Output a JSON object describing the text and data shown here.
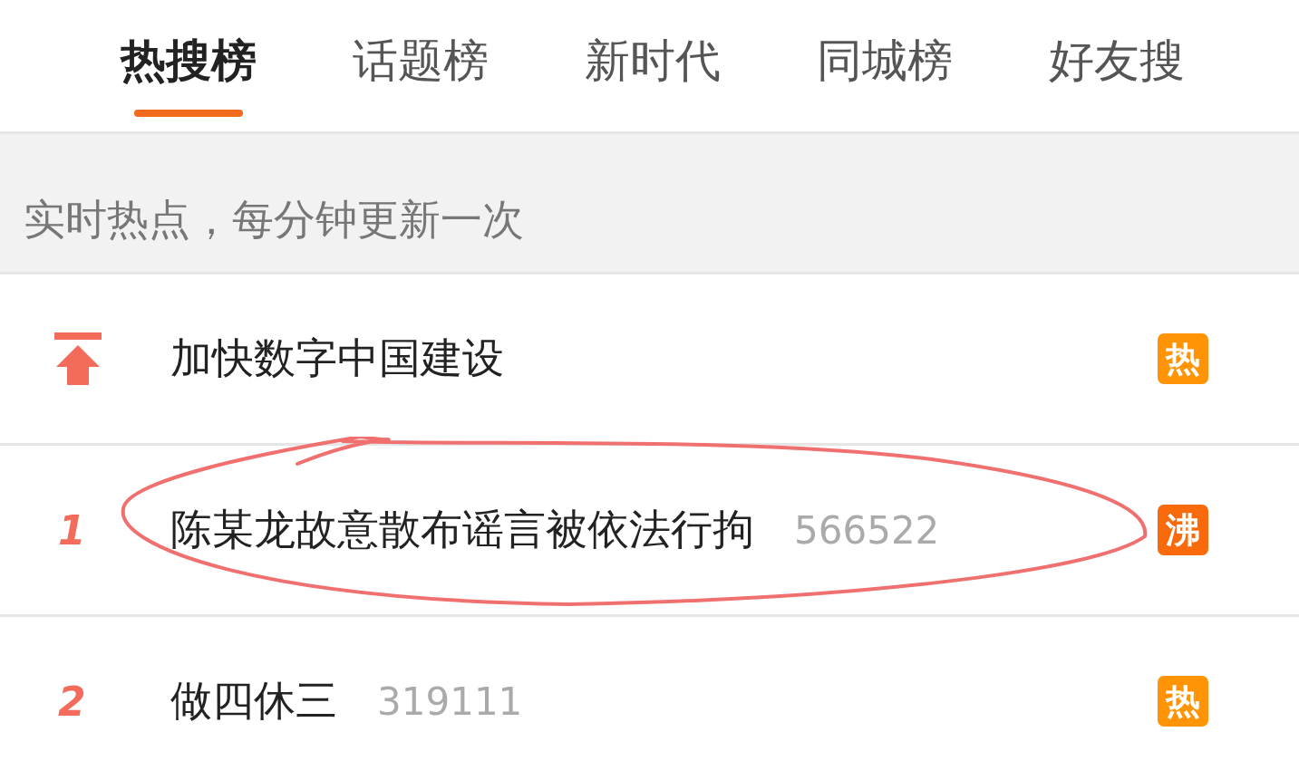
{
  "tabs": [
    {
      "label": "热搜榜",
      "selected": true
    },
    {
      "label": "话题榜",
      "selected": false
    },
    {
      "label": "新时代",
      "selected": false
    },
    {
      "label": "同城榜",
      "selected": false
    },
    {
      "label": "好友搜",
      "selected": false
    }
  ],
  "banner": "实时热点，每分钟更新一次",
  "rows": [
    {
      "kind": "pinned",
      "title": "加快数字中国建设",
      "badge": "热",
      "color": "#ff9406"
    },
    {
      "kind": "ranked",
      "rank": "1",
      "title": "陈某龙故意散布谣言被依法行拘",
      "count": "566522",
      "badge": "沸",
      "color": "#f86a0b",
      "circled": true
    },
    {
      "kind": "ranked",
      "rank": "2",
      "title": "做四休三",
      "count": "319111",
      "badge": "热",
      "color": "#ff9406"
    }
  ]
}
